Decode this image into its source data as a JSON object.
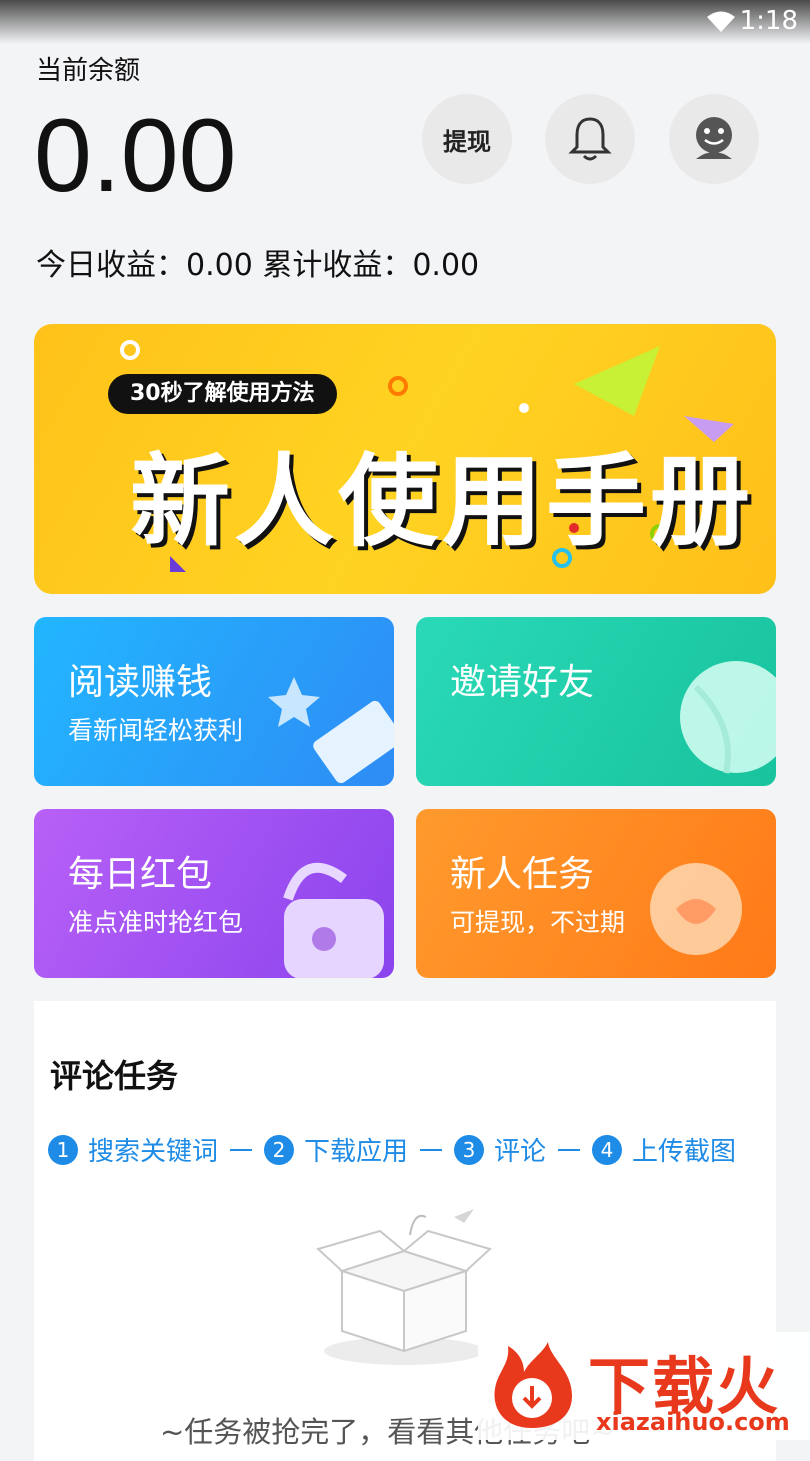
{
  "status_bar": {
    "time": "1:18"
  },
  "balance": {
    "label": "当前余额",
    "value": "0.00",
    "earnings": "今日收益：0.00 累计收益：0.00"
  },
  "actions": {
    "withdraw": "提现"
  },
  "banner": {
    "pill": "30秒了解使用方法",
    "title": "新人使用手册"
  },
  "cards": [
    {
      "title": "阅读赚钱",
      "subtitle": "看新闻轻松获利"
    },
    {
      "title": "邀请好友",
      "subtitle": ""
    },
    {
      "title": "每日红包",
      "subtitle": "准点准时抢红包"
    },
    {
      "title": "新人任务",
      "subtitle": "可提现，不过期"
    }
  ],
  "comment_task": {
    "title": "评论任务",
    "steps": [
      {
        "num": "1",
        "label": "搜索关键词"
      },
      {
        "num": "2",
        "label": "下载应用"
      },
      {
        "num": "3",
        "label": "评论"
      },
      {
        "num": "4",
        "label": "上传截图"
      }
    ],
    "empty_text": "~任务被抢完了，看看其他任务吧~"
  },
  "watermark": {
    "brand": "下载火",
    "url": "xiazaihuo.com"
  }
}
